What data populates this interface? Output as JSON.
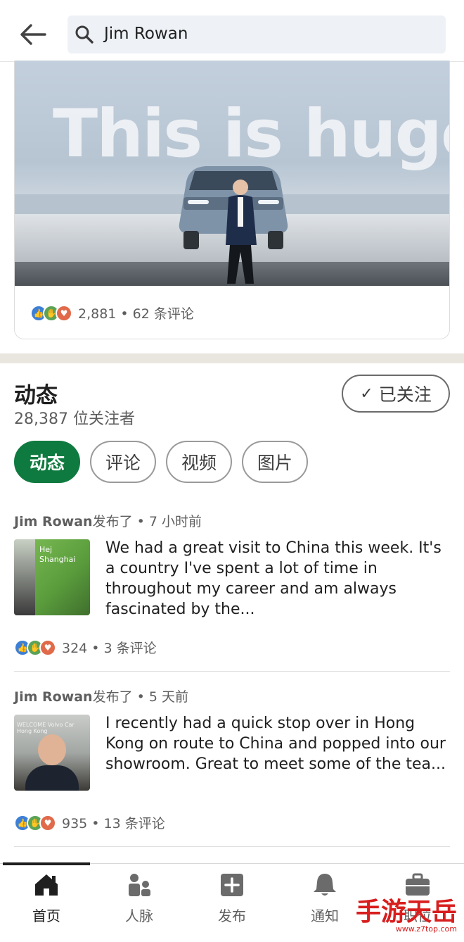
{
  "search": {
    "query": "Jim Rowan"
  },
  "hero": {
    "headline": "This is huge",
    "reactions_summary": "2,881 • 62 条评论"
  },
  "activity": {
    "title": "动态",
    "followers": "28,387 位关注者",
    "follow_label": "已关注",
    "filters": [
      {
        "label": "动态",
        "active": true
      },
      {
        "label": "评论",
        "active": false
      },
      {
        "label": "视频",
        "active": false
      },
      {
        "label": "图片",
        "active": false
      }
    ]
  },
  "posts": [
    {
      "author": "Jim Rowan",
      "action": "发布了 • 7 小时前",
      "thumb_text": "Hej Shanghai",
      "text": "We had a great visit to China this week. It's a country I've spent a lot of time in throughout my career and am always fascinated by the...",
      "reactions_summary": "324 • 3 条评论"
    },
    {
      "author": "Jim Rowan",
      "action": "发布了 • 5 天前",
      "thumb_text": "WELCOME Volvo Car Hong Kong",
      "text": "I recently had a quick stop over in Hong Kong on route to China and popped into our showroom. Great to meet some of the tea...",
      "reactions_summary": "935 • 13 条评论"
    }
  ],
  "nav": {
    "items": [
      {
        "label": "首页",
        "icon": "home-icon",
        "active": true
      },
      {
        "label": "人脉",
        "icon": "network-icon",
        "active": false
      },
      {
        "label": "发布",
        "icon": "post-icon",
        "active": false
      },
      {
        "label": "通知",
        "icon": "bell-icon",
        "active": false
      },
      {
        "label": "职位",
        "icon": "briefcase-icon",
        "active": false
      }
    ]
  },
  "watermark": {
    "brand": "手游天岳",
    "url": "www.z7top.com"
  },
  "colors": {
    "accent": "#0f7a3f",
    "like": "#3c7fd6",
    "clap": "#5aa357",
    "love": "#e06a4a"
  }
}
